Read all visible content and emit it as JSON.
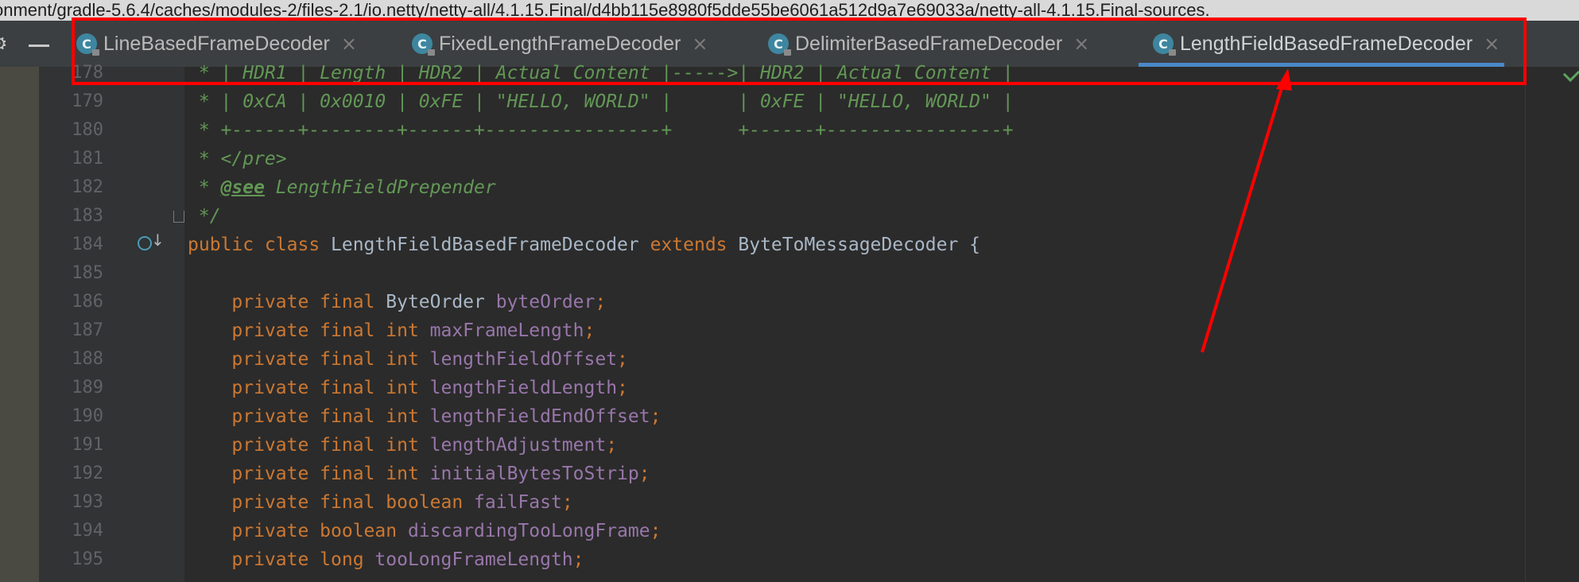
{
  "window": {
    "path": "onment/gradle-5.6.4/caches/modules-2/files-2.1/io.netty/netty-all/4.1.15.Final/d4bb115e8980f5dde55be6061a512d9a7e69033a/netty-all-4.1.15.Final-sources."
  },
  "toolstrip": {
    "gear_icon": "gear-icon",
    "minimize_icon": "minimize-icon"
  },
  "tabs": [
    {
      "label": "LineBasedFrameDecoder",
      "icon": "class-icon",
      "icon_glyph": "C",
      "close": "×",
      "active": false
    },
    {
      "label": "FixedLengthFrameDecoder",
      "icon": "class-icon",
      "icon_glyph": "C",
      "close": "×",
      "active": false
    },
    {
      "label": "DelimiterBasedFrameDecoder",
      "icon": "class-icon",
      "icon_glyph": "C",
      "close": "×",
      "active": false
    },
    {
      "label": "LengthFieldBasedFrameDecoder",
      "icon": "class-icon",
      "icon_glyph": "C",
      "close": "×",
      "active": true
    }
  ],
  "editor": {
    "lines": [
      {
        "num": "178",
        "tokens": [
          {
            "t": " * | HDR1 | Length | HDR2 | Actual Content |----->| HDR2 | Actual Content |",
            "c": "c-comment"
          }
        ]
      },
      {
        "num": "179",
        "tokens": [
          {
            "t": " * | 0xCA | 0x0010 | 0xFE | \"HELLO, WORLD\" |      | 0xFE | \"HELLO, WORLD\" |",
            "c": "c-comment"
          }
        ]
      },
      {
        "num": "180",
        "tokens": [
          {
            "t": " * +------+--------+------+----------------+      +------+----------------+",
            "c": "c-comment"
          }
        ]
      },
      {
        "num": "181",
        "tokens": [
          {
            "t": " * ",
            "c": "c-comment"
          },
          {
            "t": "</pre>",
            "c": "c-tag"
          }
        ]
      },
      {
        "num": "182",
        "tokens": [
          {
            "t": " * ",
            "c": "c-comment"
          },
          {
            "t": "@see",
            "c": "c-see"
          },
          {
            "t": " LengthFieldPrepender",
            "c": "c-comment"
          }
        ]
      },
      {
        "num": "183",
        "tokens": [
          {
            "t": " */",
            "c": "c-comment"
          }
        ]
      },
      {
        "num": "184",
        "tokens": [
          {
            "t": "public class ",
            "c": "c-kw"
          },
          {
            "t": "LengthFieldBasedFrameDecoder ",
            "c": "c-id"
          },
          {
            "t": "extends ",
            "c": "c-kw"
          },
          {
            "t": "ByteToMessageDecoder {",
            "c": "c-id"
          }
        ]
      },
      {
        "num": "185",
        "tokens": []
      },
      {
        "num": "186",
        "tokens": [
          {
            "t": "    private final ",
            "c": "c-kw"
          },
          {
            "t": "ByteOrder ",
            "c": "c-id"
          },
          {
            "t": "byteOrder",
            "c": "c-field"
          },
          {
            "t": ";",
            "c": "c-punct"
          }
        ]
      },
      {
        "num": "187",
        "tokens": [
          {
            "t": "    private final int ",
            "c": "c-kw"
          },
          {
            "t": "maxFrameLength",
            "c": "c-field"
          },
          {
            "t": ";",
            "c": "c-punct"
          }
        ]
      },
      {
        "num": "188",
        "tokens": [
          {
            "t": "    private final int ",
            "c": "c-kw"
          },
          {
            "t": "lengthFieldOffset",
            "c": "c-field"
          },
          {
            "t": ";",
            "c": "c-punct"
          }
        ]
      },
      {
        "num": "189",
        "tokens": [
          {
            "t": "    private final int ",
            "c": "c-kw"
          },
          {
            "t": "lengthFieldLength",
            "c": "c-field"
          },
          {
            "t": ";",
            "c": "c-punct"
          }
        ]
      },
      {
        "num": "190",
        "tokens": [
          {
            "t": "    private final int ",
            "c": "c-kw"
          },
          {
            "t": "lengthFieldEndOffset",
            "c": "c-field"
          },
          {
            "t": ";",
            "c": "c-punct"
          }
        ]
      },
      {
        "num": "191",
        "tokens": [
          {
            "t": "    private final int ",
            "c": "c-kw"
          },
          {
            "t": "lengthAdjustment",
            "c": "c-field"
          },
          {
            "t": ";",
            "c": "c-punct"
          }
        ]
      },
      {
        "num": "192",
        "tokens": [
          {
            "t": "    private final int ",
            "c": "c-kw"
          },
          {
            "t": "initialBytesToStrip",
            "c": "c-field"
          },
          {
            "t": ";",
            "c": "c-punct"
          }
        ]
      },
      {
        "num": "193",
        "tokens": [
          {
            "t": "    private final boolean ",
            "c": "c-kw"
          },
          {
            "t": "failFast",
            "c": "c-field"
          },
          {
            "t": ";",
            "c": "c-punct"
          }
        ]
      },
      {
        "num": "194",
        "tokens": [
          {
            "t": "    private boolean ",
            "c": "c-kw"
          },
          {
            "t": "discardingTooLongFrame",
            "c": "c-field"
          },
          {
            "t": ";",
            "c": "c-punct"
          }
        ]
      },
      {
        "num": "195",
        "tokens": [
          {
            "t": "    private long ",
            "c": "c-kw"
          },
          {
            "t": "tooLongFrameLength",
            "c": "c-field"
          },
          {
            "t": ";",
            "c": "c-punct"
          }
        ]
      }
    ]
  },
  "gutter_icons": {
    "fold_icon": "fold-icon",
    "implements_icon": "implemented-by-icon"
  },
  "annotation": {
    "color": "#ff0000"
  },
  "colors": {
    "keyword": "#cc7832",
    "comment": "#629755",
    "field": "#9876aa",
    "identifier": "#a9b7c6",
    "active_tab_underline": "#4a88c7"
  }
}
